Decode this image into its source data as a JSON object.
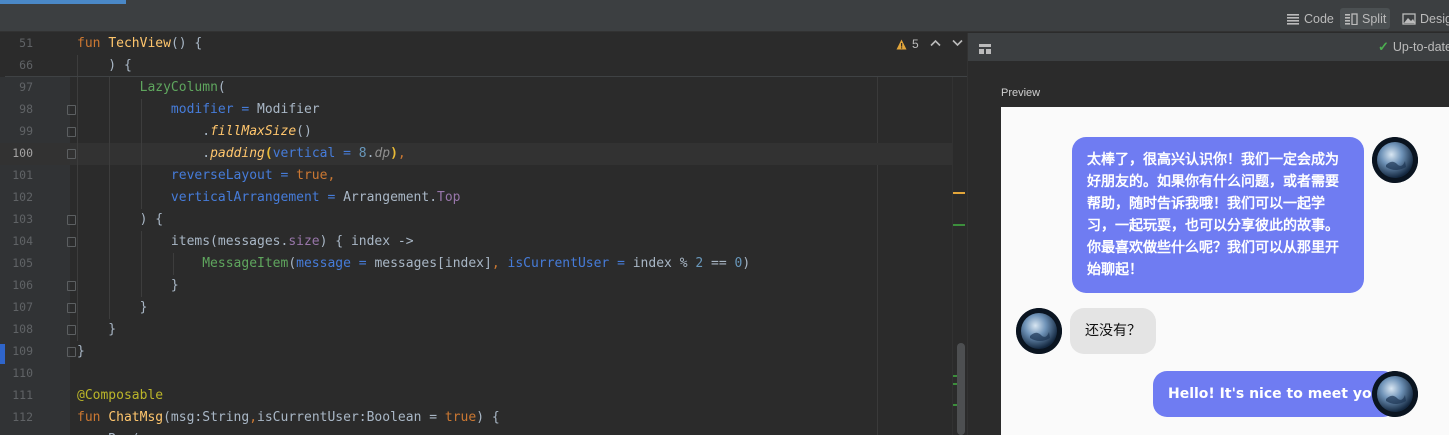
{
  "view_modes": [
    {
      "label": "Code",
      "icon": "code-lines-icon",
      "active": false
    },
    {
      "label": "Split",
      "icon": "split-view-icon",
      "active": true
    },
    {
      "label": "Design",
      "icon": "image-icon",
      "active": false
    }
  ],
  "inspections": {
    "count": "5",
    "icon": "warning-icon"
  },
  "code_lines": [
    {
      "number": "51",
      "text": "fun TechView() {"
    },
    {
      "number": "66",
      "text": "    ) {"
    },
    {
      "number": "97",
      "text": "        LazyColumn("
    },
    {
      "number": "98",
      "text": "            modifier = Modifier"
    },
    {
      "number": "99",
      "text": "                .fillMaxSize()"
    },
    {
      "number": "100",
      "text": "                .padding(vertical = 8.dp),"
    },
    {
      "number": "101",
      "text": "            reverseLayout = true,"
    },
    {
      "number": "102",
      "text": "            verticalArrangement = Arrangement.Top"
    },
    {
      "number": "103",
      "text": "        ) {"
    },
    {
      "number": "104",
      "text": "            items(messages.size) { index ->"
    },
    {
      "number": "105",
      "text": "                MessageItem(message = messages[index], isCurrentUser = index % 2 == 0)"
    },
    {
      "number": "106",
      "text": "            }"
    },
    {
      "number": "107",
      "text": "        }"
    },
    {
      "number": "108",
      "text": "    }"
    },
    {
      "number": "109",
      "text": "}"
    },
    {
      "number": "110",
      "text": ""
    },
    {
      "number": "111",
      "text": "@Composable"
    },
    {
      "number": "112",
      "text": "fun ChatMsg(msg:String,isCurrentUser:Boolean = true) {"
    }
  ],
  "preview": {
    "status": "Up-to-date",
    "label": "Preview",
    "messages": [
      {
        "text": "太棒了，很高兴认识你！我们一定会成为好朋友的。如果你有什么问题，或者需要帮助，随时告诉我哦！我们可以一起学习，一起玩耍，也可以分享彼此的故事。你最喜欢做些什么呢？我们可以从那里开始聊起！",
        "is_current_user": true
      },
      {
        "text": "还没有？",
        "is_current_user": false
      },
      {
        "text": "Hello! It's nice to meet you",
        "is_current_user": true
      }
    ]
  },
  "colors": {
    "editor_bg": "#2b2b2b",
    "toolbar_bg": "#3c3f41",
    "my_bubble": "#6f7cf2",
    "their_bubble": "#e4e4e4",
    "warning": "#e2a53a",
    "check": "#4caf50"
  }
}
